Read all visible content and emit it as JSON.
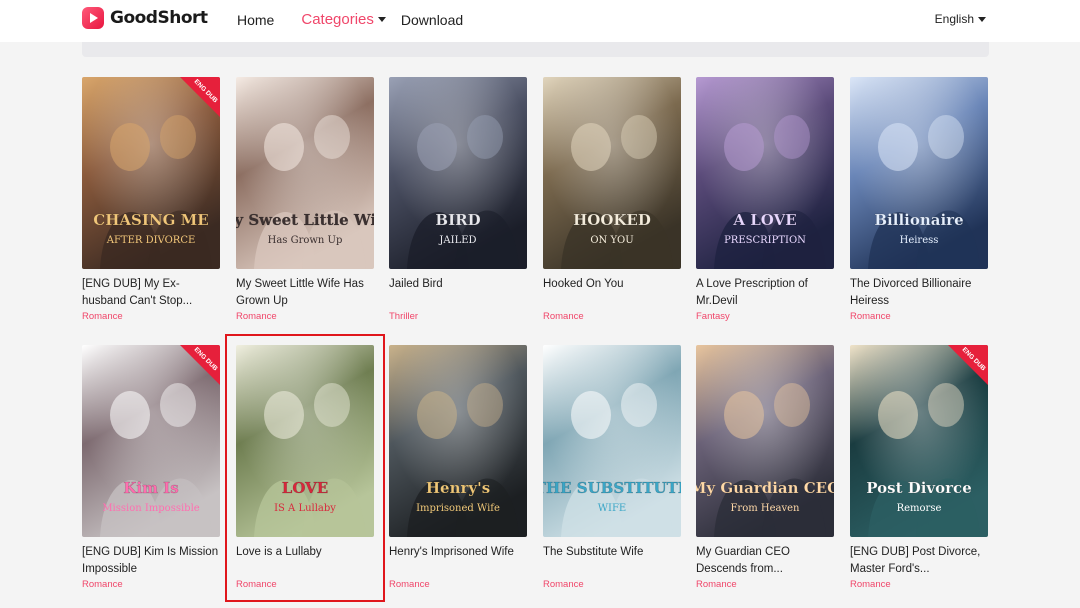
{
  "header": {
    "logo_text": "GoodShort",
    "nav": {
      "home": "Home",
      "categories": "Categories",
      "download": "Download"
    },
    "language": "English"
  },
  "colors": {
    "accent": "#f0466a",
    "highlight_border": "#e0161c"
  },
  "books": [
    {
      "title": "[ENG DUB] My Ex-husband Can't Stop...",
      "genre": "Romance",
      "cover_text": "CHASING ME",
      "cover_sub": "AFTER DIVORCE",
      "badge": "ENG DUB"
    },
    {
      "title": "My Sweet Little Wife Has Grown Up",
      "genre": "Romance",
      "cover_text": "My Sweet Little Wife",
      "cover_sub": "Has Grown Up"
    },
    {
      "title": "Jailed Bird",
      "genre": "Thriller",
      "cover_text": "BIRD",
      "cover_sub": "JAILED"
    },
    {
      "title": "Hooked On You",
      "genre": "Romance",
      "cover_text": "HOOKED",
      "cover_sub": "ON YOU"
    },
    {
      "title": "A Love Prescription of Mr.Devil",
      "genre": "Fantasy",
      "cover_text": "A LOVE",
      "cover_sub": "PRESCRIPTION"
    },
    {
      "title": "The Divorced Billionaire Heiress",
      "genre": "Romance",
      "cover_text": "Billionaire",
      "cover_sub": "Heiress"
    },
    {
      "title": "[ENG DUB] Kim Is Mission Impossible",
      "genre": "Romance",
      "cover_text": "Kim Is",
      "cover_sub": "Mission Impossible",
      "badge": "ENG DUB"
    },
    {
      "title": "Love is a Lullaby",
      "genre": "Romance",
      "cover_text": "LOVE",
      "cover_sub": "IS A Lullaby"
    },
    {
      "title": "Henry's Imprisoned Wife",
      "genre": "Romance",
      "cover_text": "Henry's",
      "cover_sub": "Imprisoned Wife"
    },
    {
      "title": "The Substitute Wife",
      "genre": "Romance",
      "cover_text": "THE SUBSTITUTE",
      "cover_sub": "WIFE"
    },
    {
      "title": "My Guardian CEO Descends from...",
      "genre": "Romance",
      "cover_text": "My Guardian CEO",
      "cover_sub": "From Heaven"
    },
    {
      "title": "[ENG DUB] Post Divorce, Master Ford's...",
      "genre": "Romance",
      "cover_text": "Post Divorce",
      "cover_sub": "Remorse",
      "badge": "ENG DUB"
    }
  ]
}
